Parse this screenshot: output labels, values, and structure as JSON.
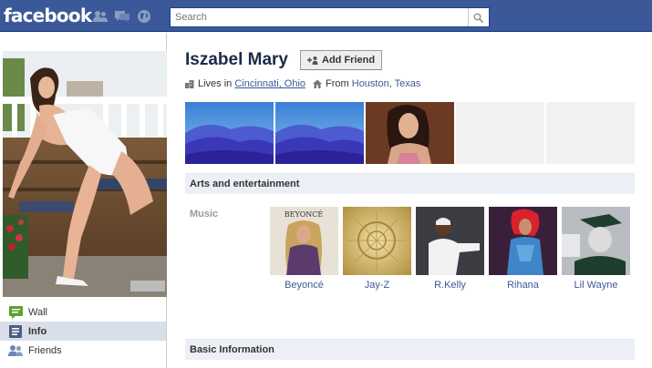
{
  "header": {
    "logo": "facebook",
    "search_placeholder": "Search",
    "jewels": [
      "friend-requests-icon",
      "messages-icon",
      "notifications-globe-icon"
    ]
  },
  "colors": {
    "brand": "#3b5998",
    "link": "#3b5998",
    "section_bg": "#eceff5",
    "nav_active_bg": "#d8dfea"
  },
  "sidebar": {
    "items": [
      {
        "label": "Wall",
        "icon": "wall-icon"
      },
      {
        "label": "Info",
        "icon": "info-icon",
        "active": true
      },
      {
        "label": "Friends",
        "icon": "friends-icon"
      }
    ]
  },
  "profile": {
    "name": "Iszabel Mary",
    "add_friend_label": "Add Friend",
    "lives_prefix": "Lives in",
    "lives_city": "Cincinnati, Ohio",
    "from_prefix": "From",
    "from_city": "Houston, Texas"
  },
  "sections": {
    "arts_title": "Arts and entertainment",
    "music_label": "Music",
    "basic_title": "Basic Information"
  },
  "music": [
    {
      "name": "Beyoncé"
    },
    {
      "name": "Jay-Z"
    },
    {
      "name": "R.Kelly"
    },
    {
      "name": "Rihana"
    },
    {
      "name": "Lil Wayne"
    }
  ],
  "album_cover_text": "BEYONCÉ"
}
